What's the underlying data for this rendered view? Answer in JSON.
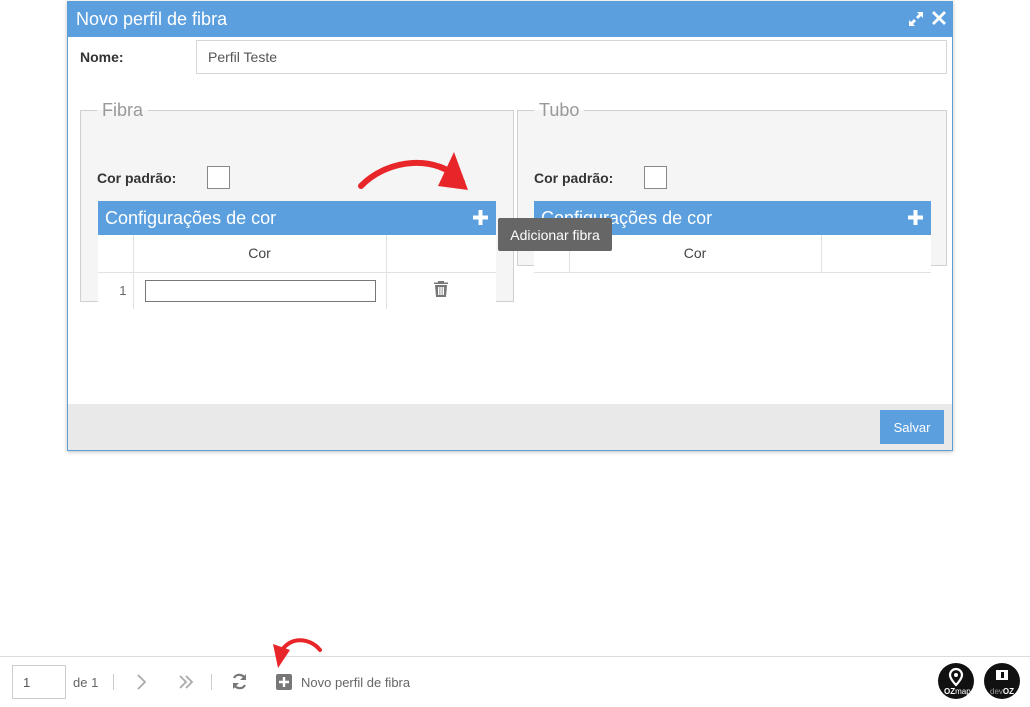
{
  "modal": {
    "title": "Novo perfil de fibra",
    "name_label": "Nome:",
    "name_value": "Perfil Teste",
    "save_label": "Salvar"
  },
  "fibra": {
    "legend": "Fibra",
    "cor_padrao_label": "Cor padrão:",
    "config_title": "Configurações de cor",
    "column_cor": "Cor",
    "rows": [
      {
        "index": "1",
        "cor": ""
      }
    ]
  },
  "tubo": {
    "legend": "Tubo",
    "cor_padrao_label": "Cor padrão:",
    "config_title": "Configurações de cor",
    "column_cor": "Cor"
  },
  "tooltip": "Adicionar fibra",
  "toolbar": {
    "page_value": "1",
    "of_label": "de 1",
    "new_profile_label": "Novo perfil de fibra"
  },
  "logos": {
    "ozmap_a": "OZ",
    "ozmap_b": "map",
    "devoz_a": "dev",
    "devoz_b": "OZ"
  },
  "colors": {
    "primary": "#5b9fde",
    "annotation_arrow": "#e8262a"
  },
  "icons": [
    "expand-icon",
    "close-icon",
    "plus-icon",
    "trash-icon",
    "chevron-right-icon",
    "double-chevron-right-icon",
    "refresh-icon",
    "plus-square-icon"
  ]
}
